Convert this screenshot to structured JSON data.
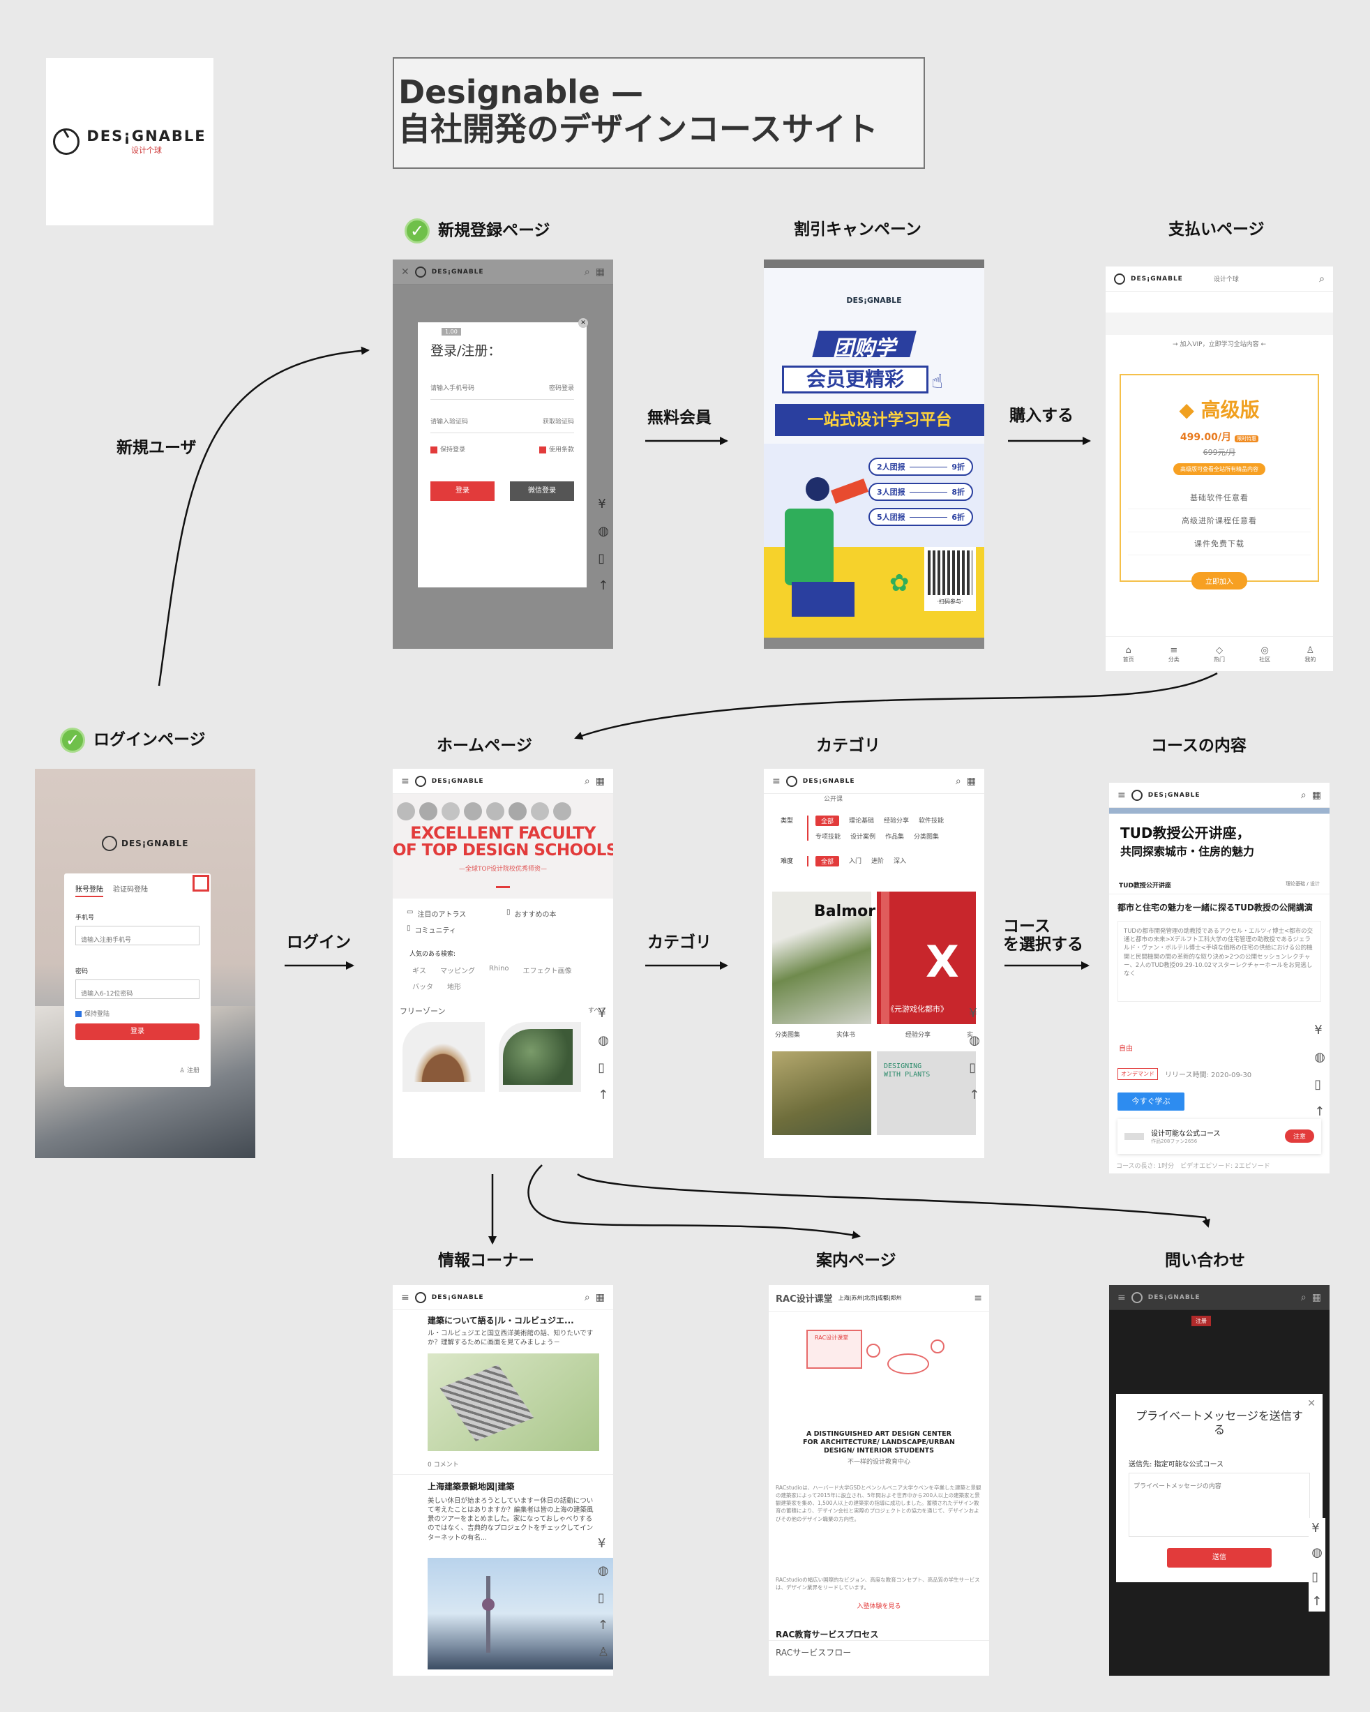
{
  "title": {
    "line1": "Designable —",
    "line2": "自社開発のデザインコースサイト"
  },
  "logo": {
    "word": "DES¡GNABLE",
    "sub": "设计个球"
  },
  "labels": {
    "signup": "新規登録ページ",
    "campaign": "割引キャンペーン",
    "payment": "支払いページ",
    "login_page": "ログインページ",
    "home": "ホームページ",
    "category": "カテゴリ",
    "course": "コースの内容",
    "info": "情報コーナー",
    "guide": "案内ページ",
    "contact": "問い合わせ"
  },
  "arrows": {
    "new_user": "新規ユーザ",
    "free_member": "無料会員",
    "purchase": "購入する",
    "login": "ログイン",
    "category": "カテゴリ",
    "select_course_1": "コース",
    "select_course_2": "を選択する"
  },
  "signup_screen": {
    "modal_title": "登录/注册：",
    "badge": "1.00",
    "phone_ph": "请输入手机号码",
    "pw_login": "密码登录",
    "code_ph": "请输入验证码",
    "get_code": "获取验证码",
    "keep_login": "保持登录",
    "terms": "使用条款",
    "login_btn": "登录",
    "wechat_btn": "微信登录"
  },
  "campaign_screen": {
    "headline1": "团购学",
    "headline2": "会员更精彩",
    "headline3": "一站式设计学习平台",
    "deals": [
      {
        "people": "2人团报",
        "discount": "9折"
      },
      {
        "people": "3人团报",
        "discount": "8折"
      },
      {
        "people": "5人团报",
        "discount": "6折"
      }
    ],
    "scan": "·扫码参与·"
  },
  "payment_screen": {
    "header_mid": "设计个球",
    "vip_note": "→ 加入VIP，立即学习全站内容 ←",
    "plan": "高级版",
    "price": "499.00/月",
    "tag": "限时特惠",
    "old_price": "699元/月",
    "promo": "高级版可查看全站所有精品内容",
    "features": [
      "基础软件任意看",
      "高级进阶课程任意看",
      "课件免费下载"
    ],
    "join_btn": "立即加入",
    "tabs": [
      "首页",
      "分类",
      "热门",
      "社区",
      "我的"
    ]
  },
  "login_screen": {
    "tab1": "账号登陆",
    "tab2": "验证码登陆",
    "phone_label": "手机号",
    "phone_ph": "请输入注册手机号",
    "pw_label": "密码",
    "pw_ph": "请输入6-12位密码",
    "keep": "保持登陆",
    "btn": "登录",
    "register": "注册"
  },
  "home_screen": {
    "banner1": "EXCELLENT FACULTY",
    "banner2": "OF TOP DESIGN SCHOOLS",
    "banner3": "—全球TOP设计院校优秀师资—",
    "menu": [
      "注目のアトラス",
      "おすすめの本",
      "コミュニティ"
    ],
    "popular_label": "人気のある検索:",
    "tags": [
      "ギス",
      "マッピング",
      "Rhino",
      "エフェクト画像",
      "バッタ",
      "地形"
    ],
    "free_zone": "フリーゾーン",
    "more": "すべて"
  },
  "category_screen": {
    "top_note": "公开课",
    "type_label": "类型",
    "types": [
      "全部",
      "理论基础",
      "经验分享",
      "软件技能",
      "专项技能",
      "设计案例",
      "作品集",
      "分类图集"
    ],
    "level_label": "难度",
    "levels": [
      "全部",
      "入门",
      "进阶",
      "深入"
    ],
    "card1": "Balmor",
    "card2_big": "X",
    "card2_caption": "《元游戏化都市》",
    "row_labels": [
      "分类图集",
      "实体书",
      "经验分享",
      "实"
    ],
    "card4_lines": [
      "DESIGNING",
      "WITH PLANTS"
    ]
  },
  "course_screen": {
    "hero1": "TUD教授公开讲座，",
    "hero2": "共同探索城市・住房的魅力",
    "sub_label": "TUD教授公开讲座",
    "sub_right": "理论基础 / 设计",
    "heading": "都市と住宅の魅力を一緒に探るTUD教授の公開講演",
    "desc": "TUDの都市開発管理の助教授であるアクセル・エルツィ博士<都市の交通と都市の未来>Xデルフト工科大学の住宅管理の助教授であるジェラルド・ヴァン・ボルテル博士<手頃な価格の住宅の供給における公的機関と民間機関の間の革新的な取り決め>2つの公開セッションレクチャー、2人のTUD教授09.29-10.02マスターレクチャーホールをお見逃しなく",
    "free": "自由",
    "status": "オンデマンド",
    "release": "リリース時間: 2020-09-30",
    "learn_btn": "今すぐ学ぶ",
    "author": "设计可能な公式コース",
    "author_sub": "作品208ファン2656",
    "follow": "注意",
    "footer": "コースの長さ: 1时分　ビデオエピソード: 2エピソード"
  },
  "info_screen": {
    "a1_title": "建築について語る|ル・コルビュジエ...",
    "a1_desc": "ル・コルビュジエと国立西洋美術館の話、知りたいですか？理解するために画面を見てみましょう－",
    "comments": "0 コメント",
    "a2_title": "上海建築景観地図|建築",
    "a2_desc": "美しい休日が始まろうとしていますー休日の話動について考えたことはありますか？編集者は皆の上海の建築風景のツアーをまとめました。家になっておしゃべりするのではなく、吉典的なプロジェクトをチェックしてインターネットの有名..."
  },
  "guide_screen": {
    "brand": "RAC设计课堂",
    "cities": "上海|苏州|北京|成都|郑州",
    "board": "RAC设计课堂",
    "heading": "A DISTINGUISHED ART DESIGN CENTER FOR ARCHITECTURE/ LANDSCAPE/URBAN DESIGN/ INTERIOR STUDENTS",
    "sub": "不一样的设计教育中心",
    "para1": "RACstudioは、ハーバード大学GSDとペンシルベニア大学ウペンを卒業した建築と景観の建築家によって2015年に設立され、5年間およそ世界中から200人以上の建築家と景観建築家を集め、1,500人以上の建築家の指導に成功しました。蓄積されたデザイン教育の蓄積により、デザイン会社と実際のプロジェクトとの協力を通じて、デザインおよびその他のデザイン職業の方向性。",
    "para2": "RACstudioの幅広い国際的なビジョン、高度な教育コンセプト、高品質の学生サービスは、デザイン業界をリードしています。",
    "link": "入塾体験を見る",
    "process": "RAC教育サービスプロセス",
    "flow": "RACサービスフロー"
  },
  "contact_screen": {
    "header_tag": "注册",
    "modal_title": "プライベートメッセージを送信する",
    "to_label": "送信先: 指定可能な公式コース",
    "placeholder": "プライベートメッセージの内容",
    "send": "送信"
  }
}
